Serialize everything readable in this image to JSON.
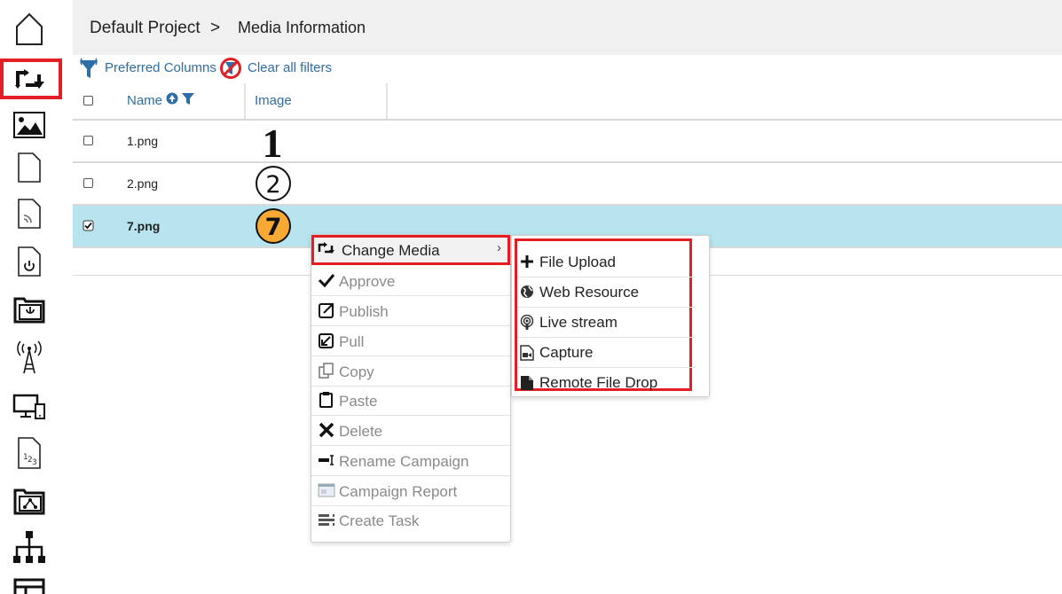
{
  "breadcrumb": {
    "project": "Default Project",
    "separator": ">",
    "page": "Media Information"
  },
  "toolbar": {
    "preferred_columns": "Preferred Columns",
    "clear_filters": "Clear all filters"
  },
  "table": {
    "headers": {
      "name": "Name",
      "image": "Image"
    },
    "rows": [
      {
        "name": "1.png",
        "thumb_label": "1",
        "selected": false
      },
      {
        "name": "2.png",
        "thumb_label": "2",
        "selected": false
      },
      {
        "name": "7.png",
        "thumb_label": "7",
        "selected": true
      }
    ]
  },
  "context_menu": {
    "items": [
      {
        "label": "Change Media",
        "icon": "change-media-icon",
        "enabled": true
      },
      {
        "label": "Approve",
        "icon": "checkmark-icon",
        "enabled": false
      },
      {
        "label": "Publish",
        "icon": "publish-icon",
        "enabled": false
      },
      {
        "label": "Pull",
        "icon": "pull-icon",
        "enabled": false
      },
      {
        "label": "Copy",
        "icon": "copy-icon",
        "enabled": false
      },
      {
        "label": "Paste",
        "icon": "paste-icon",
        "enabled": false
      },
      {
        "label": "Delete",
        "icon": "delete-icon",
        "enabled": false
      },
      {
        "label": "Rename Campaign",
        "icon": "rename-icon",
        "enabled": false
      },
      {
        "label": "Campaign Report",
        "icon": "report-icon",
        "enabled": false
      },
      {
        "label": "Create Task",
        "icon": "task-icon",
        "enabled": false
      }
    ],
    "submenu": [
      {
        "label": "File Upload",
        "icon": "plus-icon"
      },
      {
        "label": "Web Resource",
        "icon": "globe-icon"
      },
      {
        "label": "Live stream",
        "icon": "podcast-icon"
      },
      {
        "label": "Capture",
        "icon": "capture-icon"
      },
      {
        "label": "Remote File Drop",
        "icon": "file-icon"
      }
    ]
  },
  "colors": {
    "highlight_border": "#e31e24",
    "selected_row": "#b7e4ee",
    "link": "#2e6ea6",
    "badge_orange": "#f7a934"
  }
}
